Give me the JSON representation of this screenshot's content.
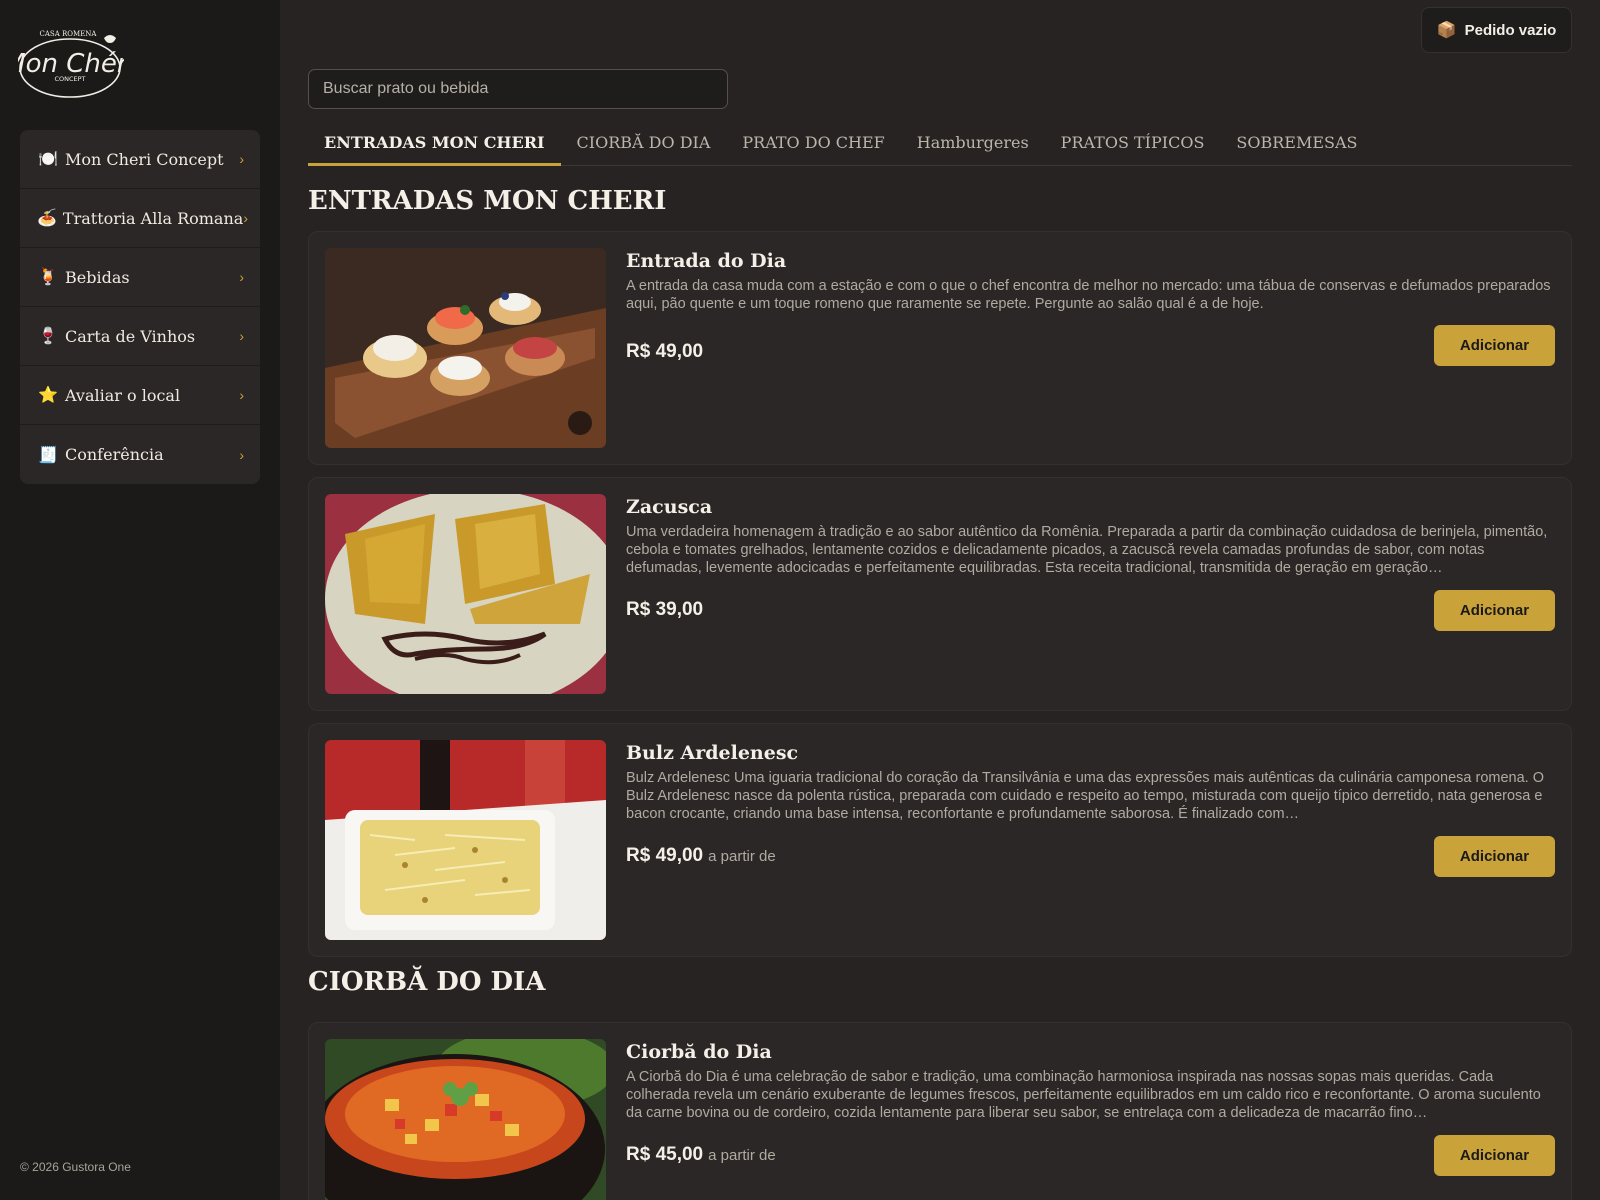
{
  "brand": {
    "logo_top": "CASA ROMENA",
    "logo_main": "Mon Chéri",
    "logo_sub": "CONCEPT"
  },
  "sidebar": {
    "items": [
      {
        "icon": "🍽️",
        "icon_name": "plate-icon",
        "label": "Mon Cheri Concept"
      },
      {
        "icon": "🍝",
        "icon_name": "pasta-icon",
        "label": "Trattoria Alla Romana"
      },
      {
        "icon": "🍹",
        "icon_name": "drink-icon",
        "label": "Bebidas"
      },
      {
        "icon": "🍷",
        "icon_name": "wine-icon",
        "label": "Carta de Vinhos"
      },
      {
        "icon": "⭐",
        "icon_name": "star-icon",
        "label": "Avaliar o local"
      },
      {
        "icon": "🧾",
        "icon_name": "receipt-icon",
        "label": "Conferência"
      }
    ],
    "chevron": "›",
    "footer": "© 2026 Gustora One"
  },
  "header": {
    "order_button_label": "Pedido vazio",
    "order_icon": "📦"
  },
  "search": {
    "placeholder": "Buscar prato ou bebida",
    "value": ""
  },
  "tabs": [
    {
      "label": "ENTRADAS MON CHERI",
      "active": true
    },
    {
      "label": "CIORBĂ DO DIA",
      "active": false
    },
    {
      "label": "PRATO DO CHEF",
      "active": false
    },
    {
      "label": "Hamburgeres",
      "active": false
    },
    {
      "label": "PRATOS TÍPICOS",
      "active": false
    },
    {
      "label": "SOBREMESAS",
      "active": false
    }
  ],
  "sections": [
    {
      "title": "ENTRADAS MON CHERI",
      "items": [
        {
          "title": "Entrada do Dia",
          "description": "A entrada da casa muda com a estação e com o que o chef encontra de melhor no mercado: uma tábua de conservas e defumados preparados aqui, pão quente e um toque romeno que raramente se repete. Pergunte ao salão qual é a de hoje.",
          "price": "R$ 49,00",
          "price_note": "",
          "button": "Adicionar"
        },
        {
          "title": "Zacusca",
          "description": "Uma verdadeira homenagem à tradição e ao sabor autêntico da Romênia. Preparada a partir da combinação cuidadosa de berinjela, pimentão, cebola e tomates grelhados, lentamente cozidos e delicadamente picados, a zacuscă revela camadas profundas de sabor, com notas defumadas, levemente adocicadas e perfeitamente equilibradas. Esta receita tradicional, transmitida de geração em geração…",
          "price": "R$ 39,00",
          "price_note": "",
          "button": "Adicionar"
        },
        {
          "title": "Bulz Ardelenesc",
          "description": "Bulz Ardelenesc Uma iguaria tradicional do coração da Transilvânia e uma das expressões mais autênticas da culinária camponesa romena. O Bulz Ardelenesc nasce da polenta rústica, preparada com cuidado e respeito ao tempo, misturada com queijo típico derretido, nata generosa e bacon crocante, criando uma base intensa, reconfortante e profundamente saborosa. É finalizado com…",
          "price": "R$ 49,00",
          "price_note": "a partir de",
          "button": "Adicionar"
        }
      ]
    },
    {
      "title": "CIORBĂ DO DIA",
      "items": [
        {
          "title": "Ciorbă do Dia",
          "description": "A Ciorbă do Dia é uma celebração de sabor e tradição, uma combinação harmoniosa inspirada nas nossas sopas mais queridas. Cada colherada revela um cenário exuberante de legumes frescos, perfeitamente equilibrados em um caldo rico e reconfortante. O aroma suculento da carne bovina ou de cordeiro, cozida lentamente para liberar seu sabor, se entrelaça com a delicadeza de macarrão fino…",
          "price": "R$ 45,00",
          "price_note": "a partir de",
          "button": "Adicionar"
        }
      ]
    }
  ],
  "colors": {
    "accent": "#c9a33a",
    "background": "#262322",
    "sidebar": "#1c1a19",
    "card": "#2a2726"
  }
}
